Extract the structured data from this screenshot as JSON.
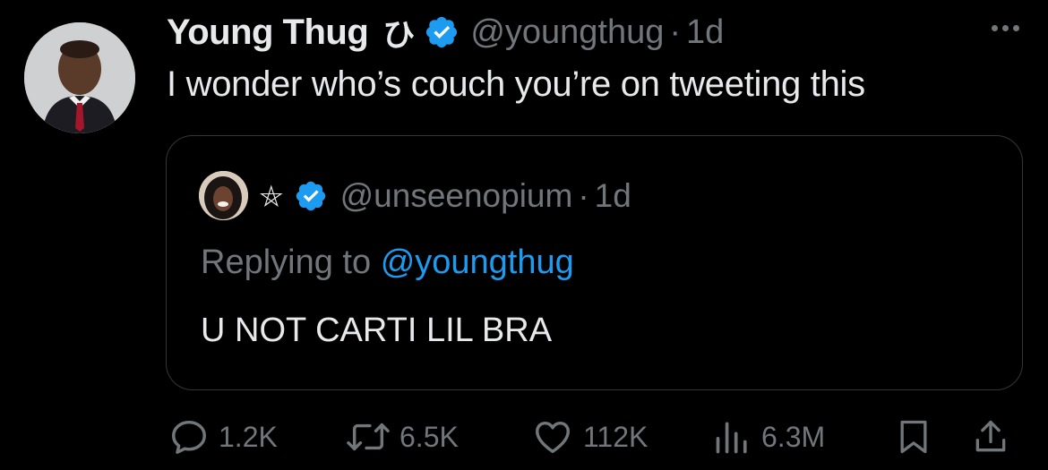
{
  "tweet": {
    "author": {
      "display_name": "Young Thug",
      "name_emoji": "ひ",
      "handle": "@youngthug",
      "verified": true
    },
    "separator": "·",
    "timestamp": "1d",
    "text": "I wonder who’s couch you’re on tweeting this",
    "more_icon": "more-horizontal-icon"
  },
  "quoted_tweet": {
    "author": {
      "display_name": "⛤",
      "handle": "@unseenopium",
      "verified": true
    },
    "separator": "·",
    "timestamp": "1d",
    "replying_prefix": "Replying to",
    "replying_to": "@youngthug",
    "text": "U NOT CARTI LIL BRA"
  },
  "actions": {
    "replies": "1.2K",
    "retweets": "6.5K",
    "likes": "112K",
    "views": "6.3M"
  },
  "colors": {
    "background": "#000000",
    "text_primary": "#e7e9ea",
    "text_secondary": "#71767b",
    "accent": "#1d9bf0",
    "border": "#333639"
  }
}
